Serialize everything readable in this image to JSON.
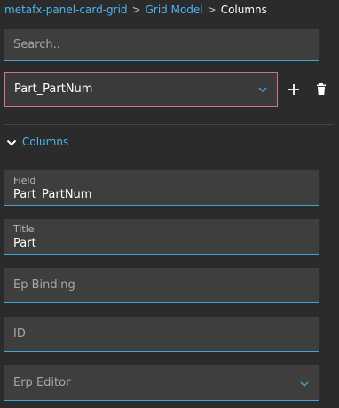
{
  "breadcrumb": {
    "items": [
      "metafx-panel-card-grid",
      "Grid Model"
    ],
    "current": "Columns",
    "separator": ">"
  },
  "search": {
    "placeholder": "Search.."
  },
  "column_select": {
    "value": "Part_PartNum",
    "icon": "chevron-down-icon"
  },
  "actions": {
    "add_icon": "plus-icon",
    "delete_icon": "trash-icon"
  },
  "section": {
    "label": "Columns",
    "expanded": true
  },
  "fields": {
    "field": {
      "label": "Field",
      "value": "Part_PartNum"
    },
    "title": {
      "label": "Title",
      "value": "Part"
    },
    "ep_binding": {
      "placeholder": "Ep Binding"
    },
    "id": {
      "placeholder": "ID"
    },
    "erp_editor": {
      "placeholder": "Erp Editor",
      "icon": "chevron-down-icon"
    }
  },
  "colors": {
    "background": "#2b2b2b",
    "field_bg": "#3e3e3e",
    "accent": "#3fa3e0",
    "link": "#4fb3f0",
    "focus_border": "#d36fa0"
  }
}
